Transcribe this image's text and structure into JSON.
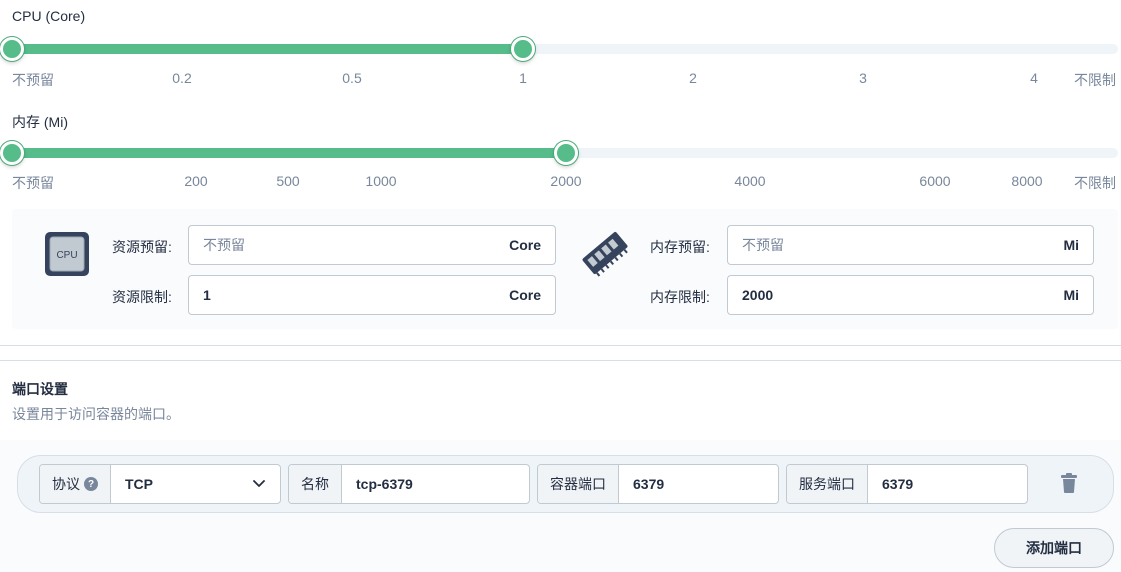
{
  "cpu": {
    "title": "CPU (Core)",
    "ticks": [
      "不预留",
      "0.2",
      "0.5",
      "1",
      "2",
      "3",
      "4",
      "不限制"
    ],
    "selected_low": "不预留",
    "selected_high": "1"
  },
  "memory": {
    "title": "内存 (Mi)",
    "ticks": [
      "不预留",
      "200",
      "500",
      "1000",
      "2000",
      "4000",
      "6000",
      "8000",
      "不限制"
    ],
    "selected_low": "不预留",
    "selected_high": "2000"
  },
  "resource_panel": {
    "cpu_icon_text": "CPU",
    "cpu_request_label": "资源预留:",
    "cpu_request_placeholder": "不预留",
    "cpu_request_unit": "Core",
    "cpu_limit_label": "资源限制:",
    "cpu_limit_value": "1",
    "cpu_limit_unit": "Core",
    "mem_request_label": "内存预留:",
    "mem_request_placeholder": "不预留",
    "mem_request_unit": "Mi",
    "mem_limit_label": "内存限制:",
    "mem_limit_value": "2000",
    "mem_limit_unit": "Mi"
  },
  "ports": {
    "title": "端口设置",
    "description": "设置用于访问容器的端口。",
    "rows": [
      {
        "protocol_label": "协议",
        "protocol_help": "?",
        "protocol_value": "TCP",
        "name_label": "名称",
        "name_value": "tcp-6379",
        "container_port_label": "容器端口",
        "container_port_value": "6379",
        "service_port_label": "服务端口",
        "service_port_value": "6379"
      }
    ],
    "add_button": "添加端口"
  }
}
